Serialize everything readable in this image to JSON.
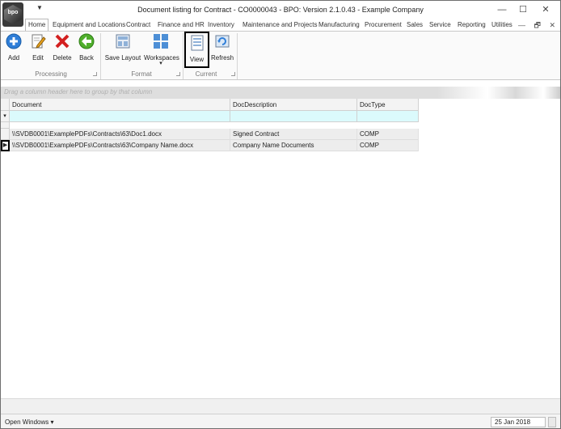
{
  "app": {
    "title": "Document listing for Contract - CO0000043 - BPO: Version 2.1.0.43 - Example Company",
    "logo_text": "bpo",
    "qat_symbol": "▼",
    "window_controls": [
      "—",
      "☐",
      "✕"
    ]
  },
  "tabs": [
    {
      "label": "Home",
      "active": true
    },
    {
      "label": "Equipment and Locations"
    },
    {
      "label": "Contract"
    },
    {
      "label": "Finance and HR"
    },
    {
      "label": "Inventory"
    },
    {
      "label": "Maintenance and Projects"
    },
    {
      "label": "Manufacturing"
    },
    {
      "label": "Procurement"
    },
    {
      "label": "Sales"
    },
    {
      "label": "Service"
    },
    {
      "label": "Reporting"
    },
    {
      "label": "Utilities"
    }
  ],
  "tab_controls": [
    "—",
    "🗗",
    "✕"
  ],
  "ribbon": {
    "processing": {
      "label": "Processing",
      "buttons": [
        {
          "label": "Add",
          "icon": "add-icon"
        },
        {
          "label": "Edit",
          "icon": "edit-icon"
        },
        {
          "label": "Delete",
          "icon": "delete-icon"
        },
        {
          "label": "Back",
          "icon": "back-icon"
        }
      ]
    },
    "format": {
      "label": "Format",
      "buttons": [
        {
          "label": "Save Layout",
          "icon": "save-layout-icon"
        },
        {
          "label": "Workspaces",
          "icon": "workspaces-icon",
          "dropdown": "▾"
        }
      ]
    },
    "current": {
      "label": "Current",
      "buttons": [
        {
          "label": "View",
          "icon": "view-icon",
          "selected": true
        },
        {
          "label": "Refresh",
          "icon": "refresh-icon"
        }
      ]
    }
  },
  "group_panel": {
    "text": "Drag a column header here to group by that column"
  },
  "grid": {
    "columns": [
      "Document",
      "DocDescription",
      "DocType"
    ],
    "filter_icon": "▾",
    "rows": [
      [
        "\\\\SVDB0001\\ExamplePDFs\\Contracts\\63\\Doc1.docx",
        "Signed Contract",
        "COMP"
      ],
      [
        "\\\\SVDB0001\\ExamplePDFs\\Contracts\\63\\Company Name.docx",
        "Company Name Documents",
        "COMP"
      ]
    ],
    "current_row_indicator": "▶"
  },
  "statusbar": {
    "open_windows": "Open Windows ▾",
    "date": "25 Jan 2018"
  },
  "colors": {
    "filter_row": "#dbfafc",
    "row_bg": "#ededed",
    "accent": "#1f6fb2"
  }
}
